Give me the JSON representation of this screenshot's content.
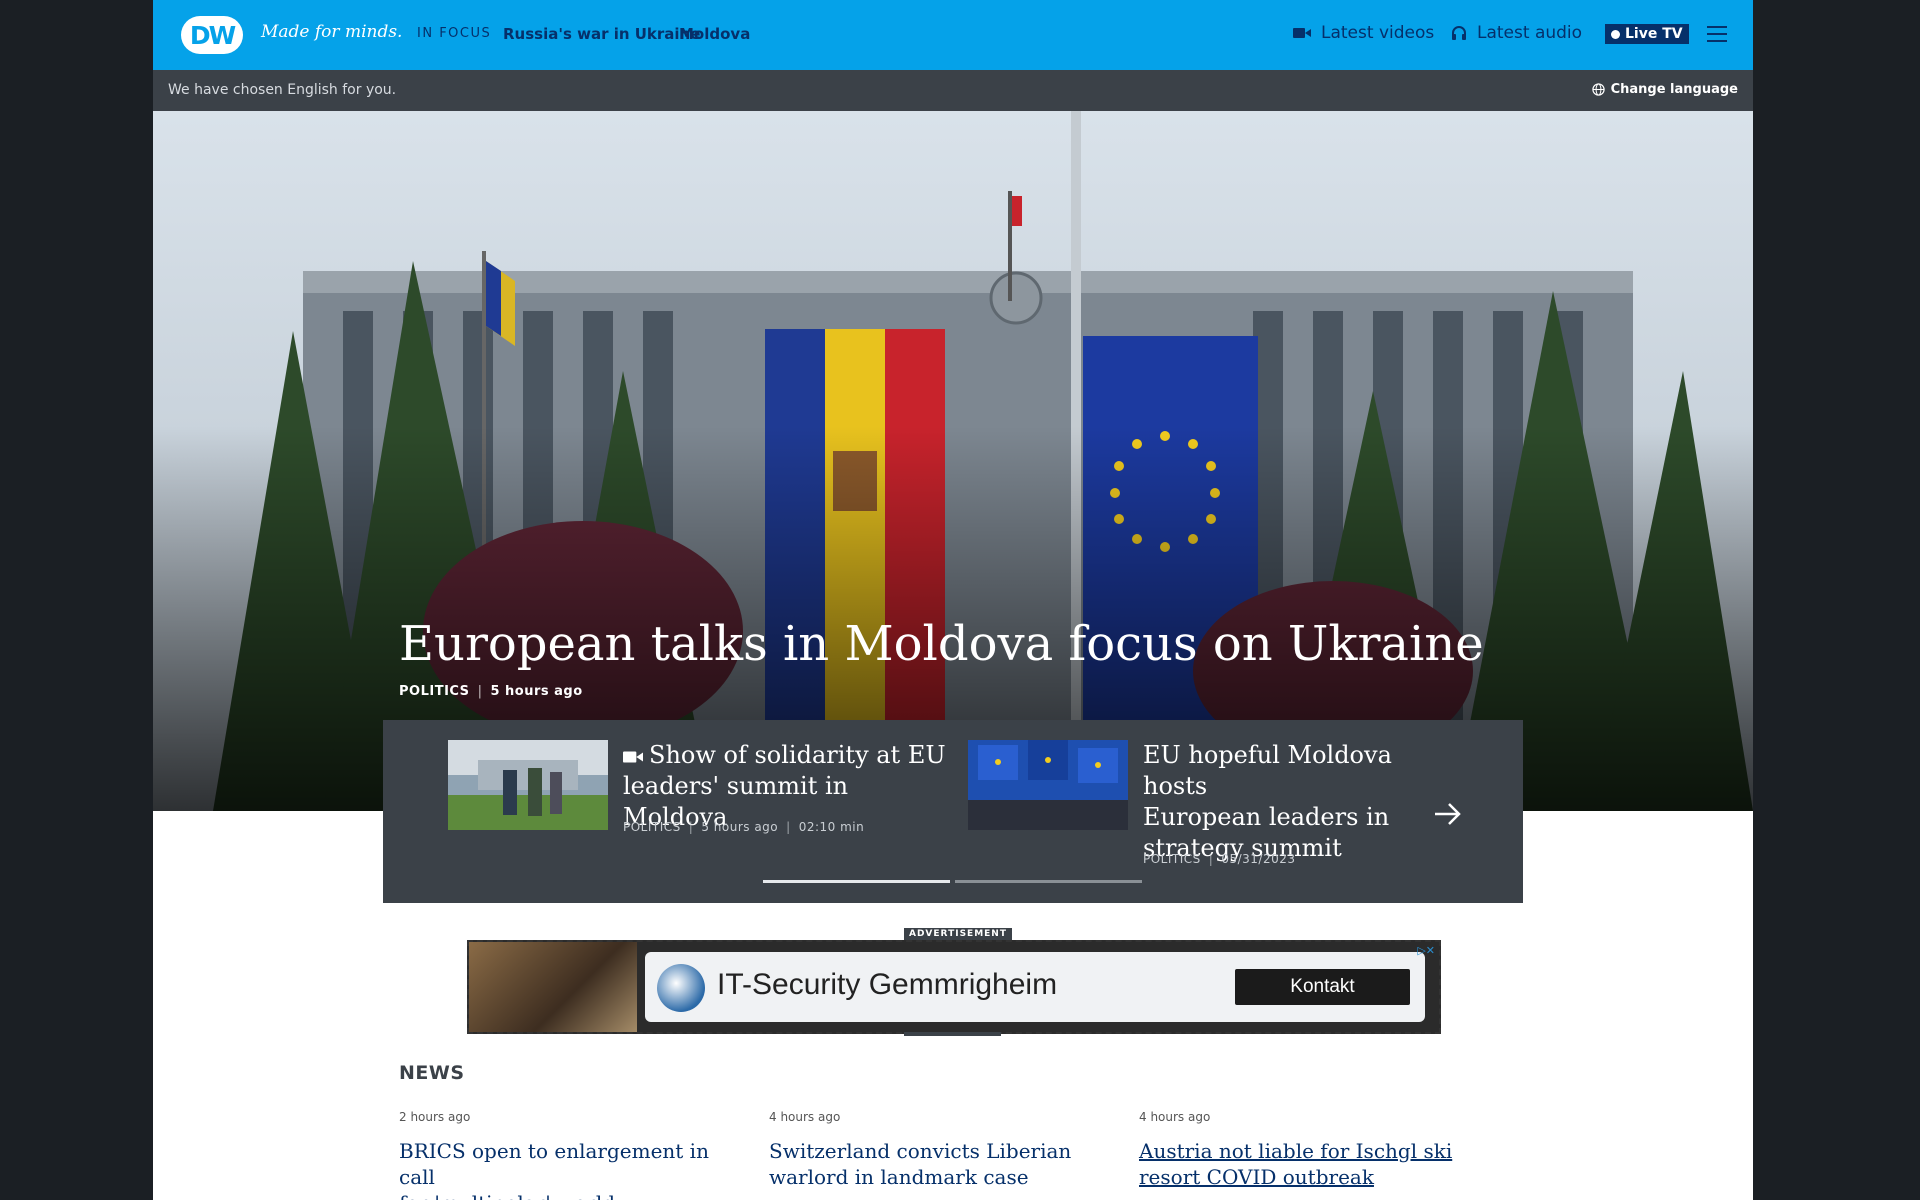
{
  "header": {
    "logo_text": "DW",
    "tagline": "Made for minds.",
    "in_focus_label": "IN FOCUS",
    "topics": [
      "Russia's war in Ukraine",
      "Moldova"
    ],
    "latest_videos": "Latest videos",
    "latest_audio": "Latest audio",
    "live_tv": "Live TV"
  },
  "language_bar": {
    "message": "We have chosen English for you.",
    "change_label": "Change language"
  },
  "hero": {
    "title": "European talks in Moldova focus on Ukraine",
    "category": "POLITICS",
    "time": "5 hours ago"
  },
  "related": [
    {
      "title_line1": "Show of solidarity at EU",
      "title_line2": "leaders' summit in Moldova",
      "category": "POLITICS",
      "time": "5 hours ago",
      "duration": "02:10 min"
    },
    {
      "title_line1": "EU hopeful Moldova hosts",
      "title_line2": "European leaders in",
      "title_line3": "strategy summit",
      "category": "POLITICS",
      "date": "05/31/2023"
    }
  ],
  "ad": {
    "label": "ADVERTISEMENT",
    "headline": "IT-Security Gemmrigheim",
    "button": "Kontakt"
  },
  "news": {
    "heading": "NEWS",
    "items": [
      {
        "time": "2 hours ago",
        "line1": "BRICS open to enlargement in call",
        "line2": "for 'multipolar' world"
      },
      {
        "time": "4 hours ago",
        "line1": "Switzerland convicts Liberian",
        "line2": "warlord in landmark case"
      },
      {
        "time": "4 hours ago",
        "line1": "Austria not liable for Ischgl ski",
        "line2": "resort COVID outbreak"
      }
    ]
  },
  "colors": {
    "brand_blue": "#05a2e9",
    "navy": "#06306a",
    "dark_panel": "#3b4148"
  },
  "icons": [
    "video-camera-icon",
    "headphones-icon",
    "globe-icon",
    "menu-icon",
    "arrow-right-icon",
    "ad-close-icon"
  ]
}
